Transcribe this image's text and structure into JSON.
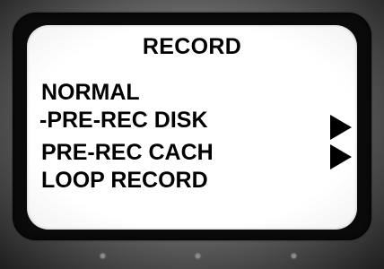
{
  "screen": {
    "title": "RECORD",
    "menu_items": [
      {
        "label": "NORMAL",
        "has_submenu": false
      },
      {
        "label": "-PRE-REC DISK",
        "has_submenu": true
      },
      {
        "label": "PRE-REC CACH",
        "has_submenu": true
      },
      {
        "label": "LOOP RECORD",
        "has_submenu": false
      }
    ],
    "selected_label": "-PRE-REC DISK",
    "arrow_icon": "right-triangle-icon"
  },
  "colors": {
    "screen_background": "#ffffff",
    "text": "#000000",
    "bezel": "#0a0a0a",
    "housing": "#6e6e6e"
  }
}
